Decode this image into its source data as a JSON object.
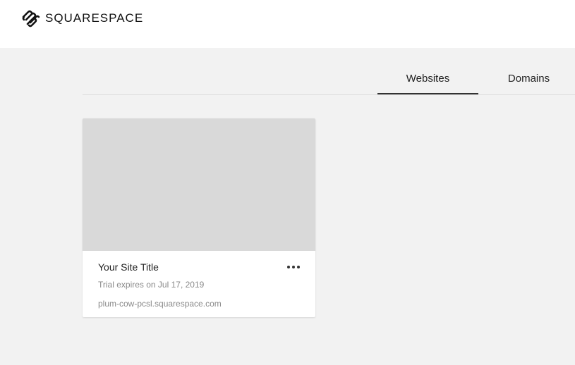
{
  "header": {
    "logo_text": "SQUARESPACE",
    "logo_icon": "squarespace-logo-icon"
  },
  "tabs": [
    {
      "label": "Websites",
      "active": true
    },
    {
      "label": "Domains",
      "active": false
    }
  ],
  "site_card": {
    "title": "Your Site Title",
    "trial_text": "Trial expires on Jul 17, 2019",
    "domain": "plum-cow-pcsl.squarespace.com",
    "more_icon": "more-horizontal-icon"
  }
}
